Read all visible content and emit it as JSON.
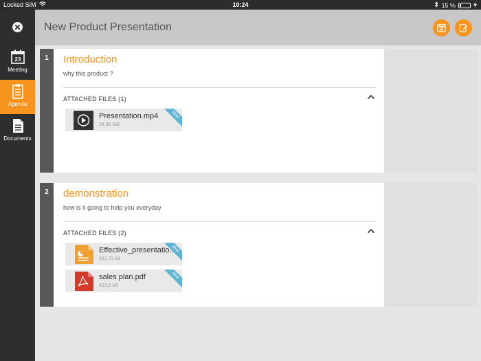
{
  "status_bar": {
    "carrier": "Locked SIM",
    "time": "10:24",
    "battery": "15 %"
  },
  "sidebar": {
    "items": [
      {
        "label": "Meeting",
        "icon": "calendar-icon",
        "calendar_day": "23",
        "active": false
      },
      {
        "label": "Agenda",
        "icon": "clipboard-icon",
        "active": true
      },
      {
        "label": "Documents",
        "icon": "document-icon",
        "active": false
      }
    ]
  },
  "header": {
    "title": "New Product Presentation",
    "actions": [
      "calendar-settings-icon",
      "edit-note-icon"
    ]
  },
  "agenda": [
    {
      "number": "1",
      "title": "Introduction",
      "description": "why this product ?",
      "files_header": "ATTACHED FILES (1)",
      "files": [
        {
          "name": "Presentation.mp4",
          "size": "34,96 MB",
          "type": "video",
          "badge": "New"
        }
      ]
    },
    {
      "number": "2",
      "title": "demonstration",
      "description": "how is it going to help you everyday",
      "files_header": "ATTACHED FILES (2)",
      "files": [
        {
          "name": "Effective_presentatio...",
          "size": "542,72 kB",
          "type": "presentation",
          "badge": "New"
        },
        {
          "name": "sales plan.pdf",
          "size": "423,5 kB",
          "type": "pdf",
          "badge": "New"
        }
      ]
    }
  ],
  "colors": {
    "accent": "#f7941e",
    "sidebar_bg": "#2e2e2e",
    "badge": "#5fb3d3"
  }
}
